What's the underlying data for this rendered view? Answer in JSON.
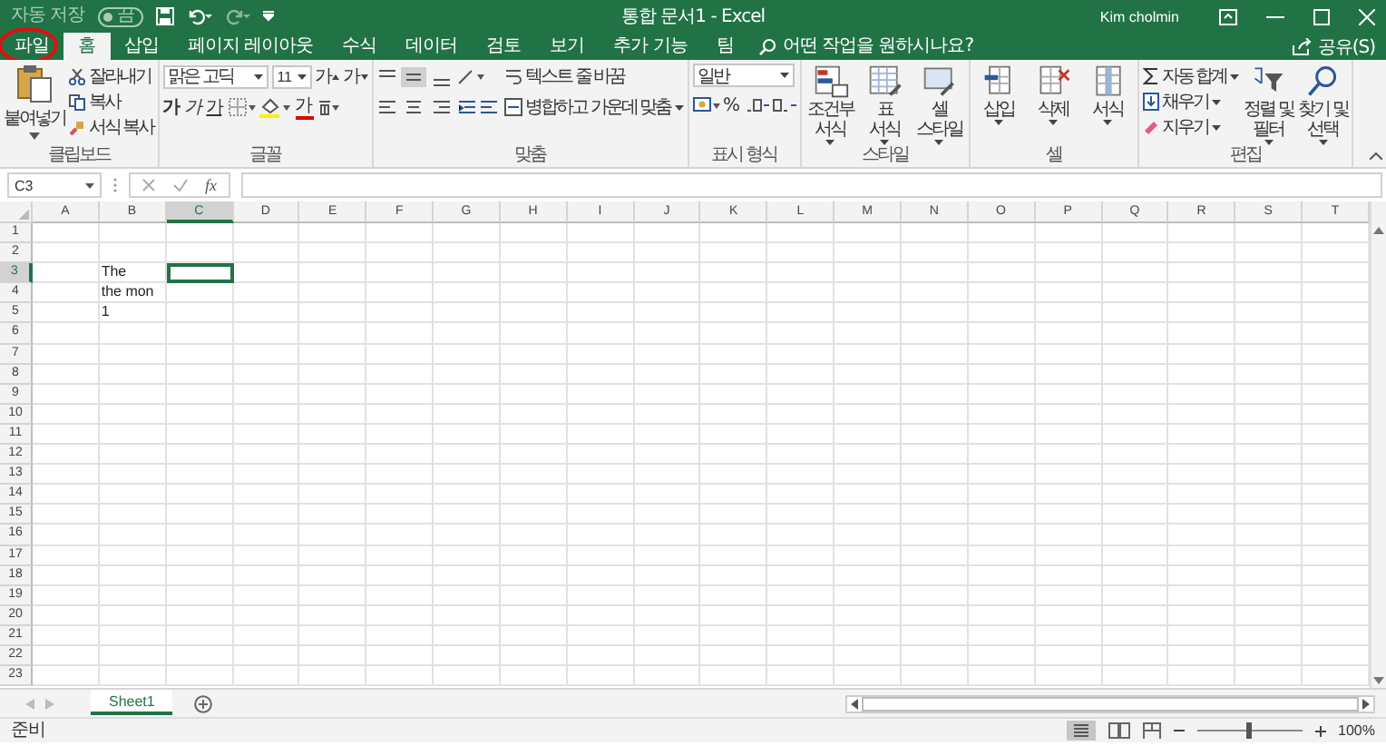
{
  "quick_access": {
    "autosave": {
      "label": "자동 저장",
      "on": false,
      "state_text": "끔"
    }
  },
  "window": {
    "title": "통합 문서1 - Excel",
    "user": "Kim cholmin"
  },
  "tabs": [
    {
      "label": "파일",
      "selected": false,
      "highlighted": true
    },
    {
      "label": "홈",
      "selected": true,
      "highlighted": false
    },
    {
      "label": "삽입",
      "selected": false,
      "highlighted": false
    },
    {
      "label": "페이지 레이아웃",
      "selected": false,
      "highlighted": false
    },
    {
      "label": "수식",
      "selected": false,
      "highlighted": false
    },
    {
      "label": "데이터",
      "selected": false,
      "highlighted": false
    },
    {
      "label": "검토",
      "selected": false,
      "highlighted": false
    },
    {
      "label": "보기",
      "selected": false,
      "highlighted": false
    },
    {
      "label": "추가 기능",
      "selected": false,
      "highlighted": false
    },
    {
      "label": "팀",
      "selected": false,
      "highlighted": false
    }
  ],
  "tell_me": {
    "placeholder": "어떤 작업을 원하시나요?"
  },
  "share": {
    "label": "공유(S)"
  },
  "ribbon": [
    {
      "kind": "clipboard",
      "label": "클립보드",
      "paste": "붙여넣기",
      "items": [
        "잘라내기",
        "복사",
        "서식 복사"
      ]
    },
    {
      "kind": "font",
      "label": "글꼴",
      "font": "맑은 고딕",
      "size": "11",
      "grow": "가",
      "shrink": "가",
      "bold": "가",
      "italic": "가",
      "underline": "가",
      "color_letter": "가"
    },
    {
      "kind": "alignment",
      "label": "맞춤",
      "wrap": "텍스트 줄 바꿈",
      "merge": "병합하고 가운데 맞춤"
    },
    {
      "kind": "number",
      "label": "표시 형식",
      "format": "일반",
      "percent": "%"
    },
    {
      "kind": "styles",
      "label": "스타일",
      "buttons": [
        [
          "조건부",
          "서식"
        ],
        [
          "표",
          "서식"
        ],
        [
          "셀",
          "스타일"
        ]
      ]
    },
    {
      "kind": "cells",
      "label": "셀",
      "buttons": [
        [
          "삽입"
        ],
        [
          "삭제"
        ],
        [
          "서식"
        ]
      ]
    },
    {
      "kind": "editing",
      "label": "편집",
      "items": [
        "자동 합계",
        "채우기",
        "지우기"
      ],
      "buttons": [
        [
          "정렬 및",
          "필터"
        ],
        [
          "찾기 및",
          "선택"
        ]
      ]
    }
  ],
  "formula_bar": {
    "name_box": "C3",
    "function_label": "fx"
  },
  "sheet": {
    "columns": [
      {
        "label": "A",
        "selected": false
      },
      {
        "label": "B",
        "selected": false
      },
      {
        "label": "C",
        "selected": true
      },
      {
        "label": "D",
        "selected": false
      },
      {
        "label": "E",
        "selected": false
      },
      {
        "label": "F",
        "selected": false
      },
      {
        "label": "G",
        "selected": false
      },
      {
        "label": "H",
        "selected": false
      },
      {
        "label": "I",
        "selected": false
      },
      {
        "label": "J",
        "selected": false
      },
      {
        "label": "K",
        "selected": false
      },
      {
        "label": "L",
        "selected": false
      },
      {
        "label": "M",
        "selected": false
      },
      {
        "label": "N",
        "selected": false
      },
      {
        "label": "O",
        "selected": false
      },
      {
        "label": "P",
        "selected": false
      },
      {
        "label": "Q",
        "selected": false
      },
      {
        "label": "R",
        "selected": false
      },
      {
        "label": "S",
        "selected": false
      },
      {
        "label": "T",
        "selected": false
      }
    ],
    "rows": [
      {
        "label": "1",
        "selected": false,
        "cells": []
      },
      {
        "label": "2",
        "selected": false,
        "cells": []
      },
      {
        "label": "3",
        "selected": true,
        "cells": [
          null,
          "The"
        ]
      },
      {
        "label": "4",
        "selected": false,
        "cells": [
          null,
          "the mon"
        ]
      },
      {
        "label": "5",
        "selected": false,
        "cells": [
          null,
          "1"
        ]
      },
      {
        "label": "6",
        "selected": false,
        "cells": []
      },
      {
        "label": "7",
        "selected": false,
        "cells": []
      },
      {
        "label": "8",
        "selected": false,
        "cells": []
      },
      {
        "label": "9",
        "selected": false,
        "cells": []
      },
      {
        "label": "10",
        "selected": false,
        "cells": []
      },
      {
        "label": "11",
        "selected": false,
        "cells": []
      },
      {
        "label": "12",
        "selected": false,
        "cells": []
      },
      {
        "label": "13",
        "selected": false,
        "cells": []
      },
      {
        "label": "14",
        "selected": false,
        "cells": []
      },
      {
        "label": "15",
        "selected": false,
        "cells": []
      },
      {
        "label": "16",
        "selected": false,
        "cells": []
      },
      {
        "label": "17",
        "selected": false,
        "cells": []
      },
      {
        "label": "18",
        "selected": false,
        "cells": []
      },
      {
        "label": "19",
        "selected": false,
        "cells": []
      },
      {
        "label": "20",
        "selected": false,
        "cells": []
      },
      {
        "label": "21",
        "selected": false,
        "cells": []
      },
      {
        "label": "22",
        "selected": false,
        "cells": []
      },
      {
        "label": "23",
        "selected": false,
        "cells": []
      }
    ]
  },
  "sheet_tabs": [
    {
      "label": "Sheet1",
      "selected": true
    }
  ],
  "status_bar": {
    "status": "준비",
    "zoom": "100%",
    "zoom_level": {
      "level": 0.5
    }
  }
}
